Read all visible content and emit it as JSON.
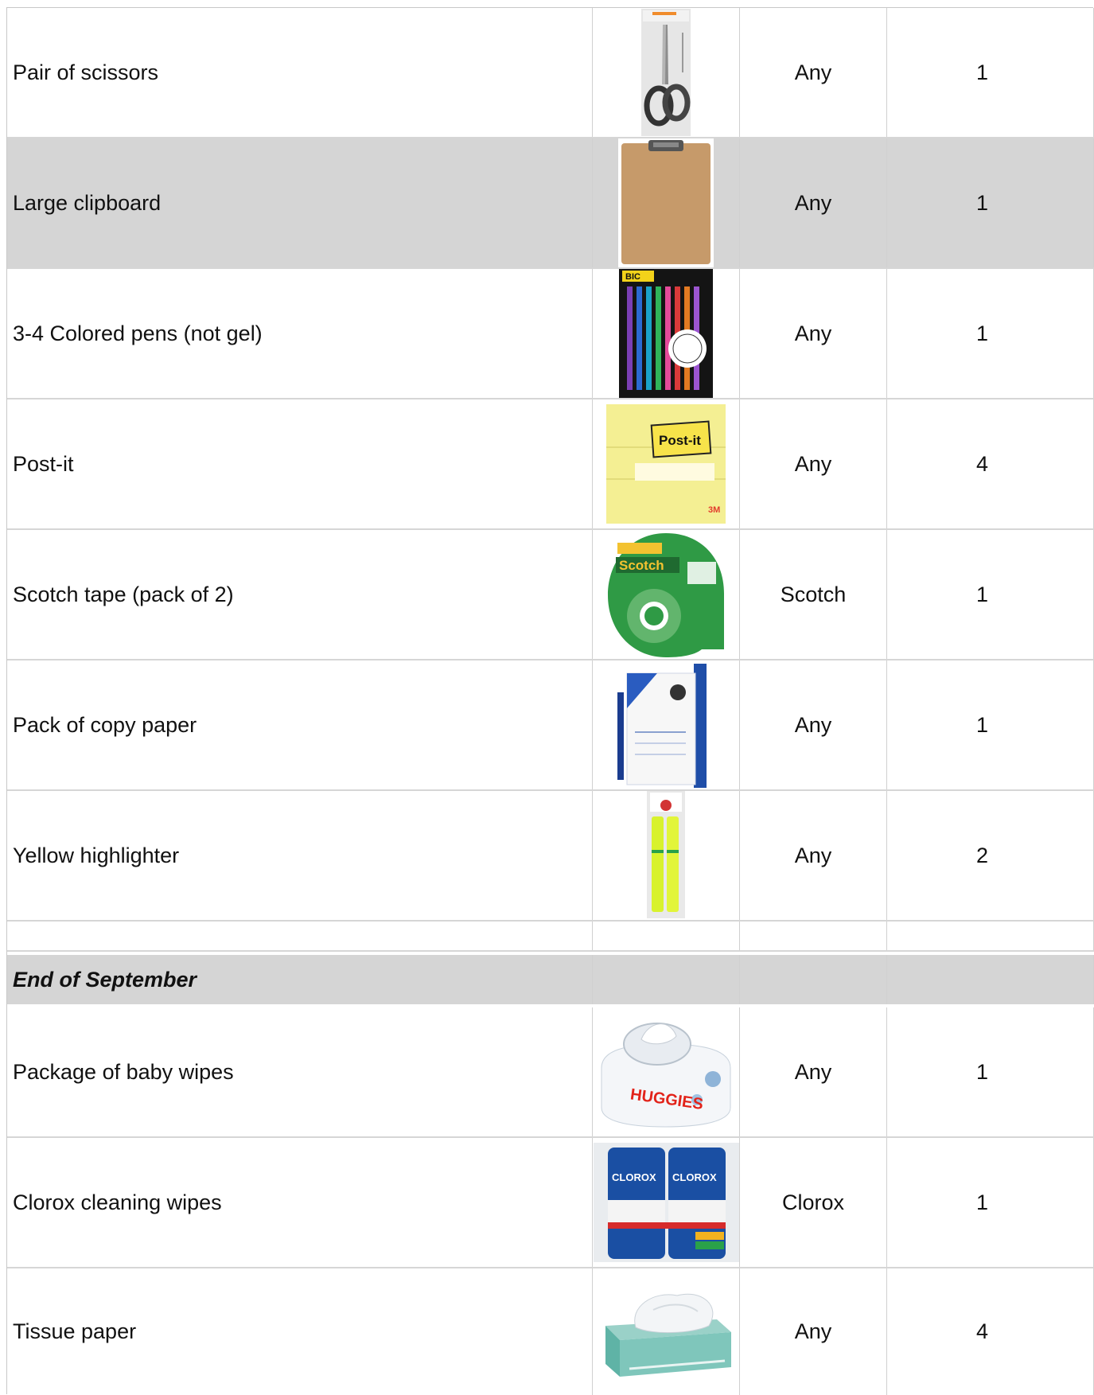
{
  "rows": [
    {
      "item": "Pair of scissors",
      "image": "scissors-product-image",
      "brand": "Any",
      "qty": "1"
    },
    {
      "item": "Large clipboard",
      "image": "clipboard-product-image",
      "brand": "Any",
      "qty": "1"
    },
    {
      "item": "3-4 Colored pens (not gel)",
      "image": "colored-pens-product-image",
      "brand": "Any",
      "qty": "1",
      "image_text": "BIC"
    },
    {
      "item": "Post-it",
      "image": "post-it-product-image",
      "brand": "Any",
      "qty": "4",
      "image_text": "Post-it"
    },
    {
      "item": "Scotch tape (pack of 2)",
      "image": "scotch-tape-product-image",
      "brand": "Scotch",
      "qty": "1",
      "image_text": "Scotch"
    },
    {
      "item": "Pack of copy paper",
      "image": "copy-paper-product-image",
      "brand": "Any",
      "qty": "1"
    },
    {
      "item": "Yellow highlighter",
      "image": "highlighter-product-image",
      "brand": "Any",
      "qty": "2"
    },
    {
      "item": "",
      "brand": "",
      "qty": ""
    },
    {
      "section": "End of September"
    },
    {
      "item": "Package of baby wipes",
      "image": "baby-wipes-product-image",
      "brand": "Any",
      "qty": "1",
      "image_text": "HUGGIES"
    },
    {
      "item": "Clorox cleaning wipes",
      "image": "clorox-wipes-product-image",
      "brand": "Clorox",
      "qty": "1",
      "image_text": "CLOROX"
    },
    {
      "item": "Tissue paper",
      "image": "tissue-box-product-image",
      "brand": "Any",
      "qty": "4"
    }
  ],
  "colors": {
    "shaded_row": "#d5d5d5",
    "grid": "#d0d0d0"
  }
}
